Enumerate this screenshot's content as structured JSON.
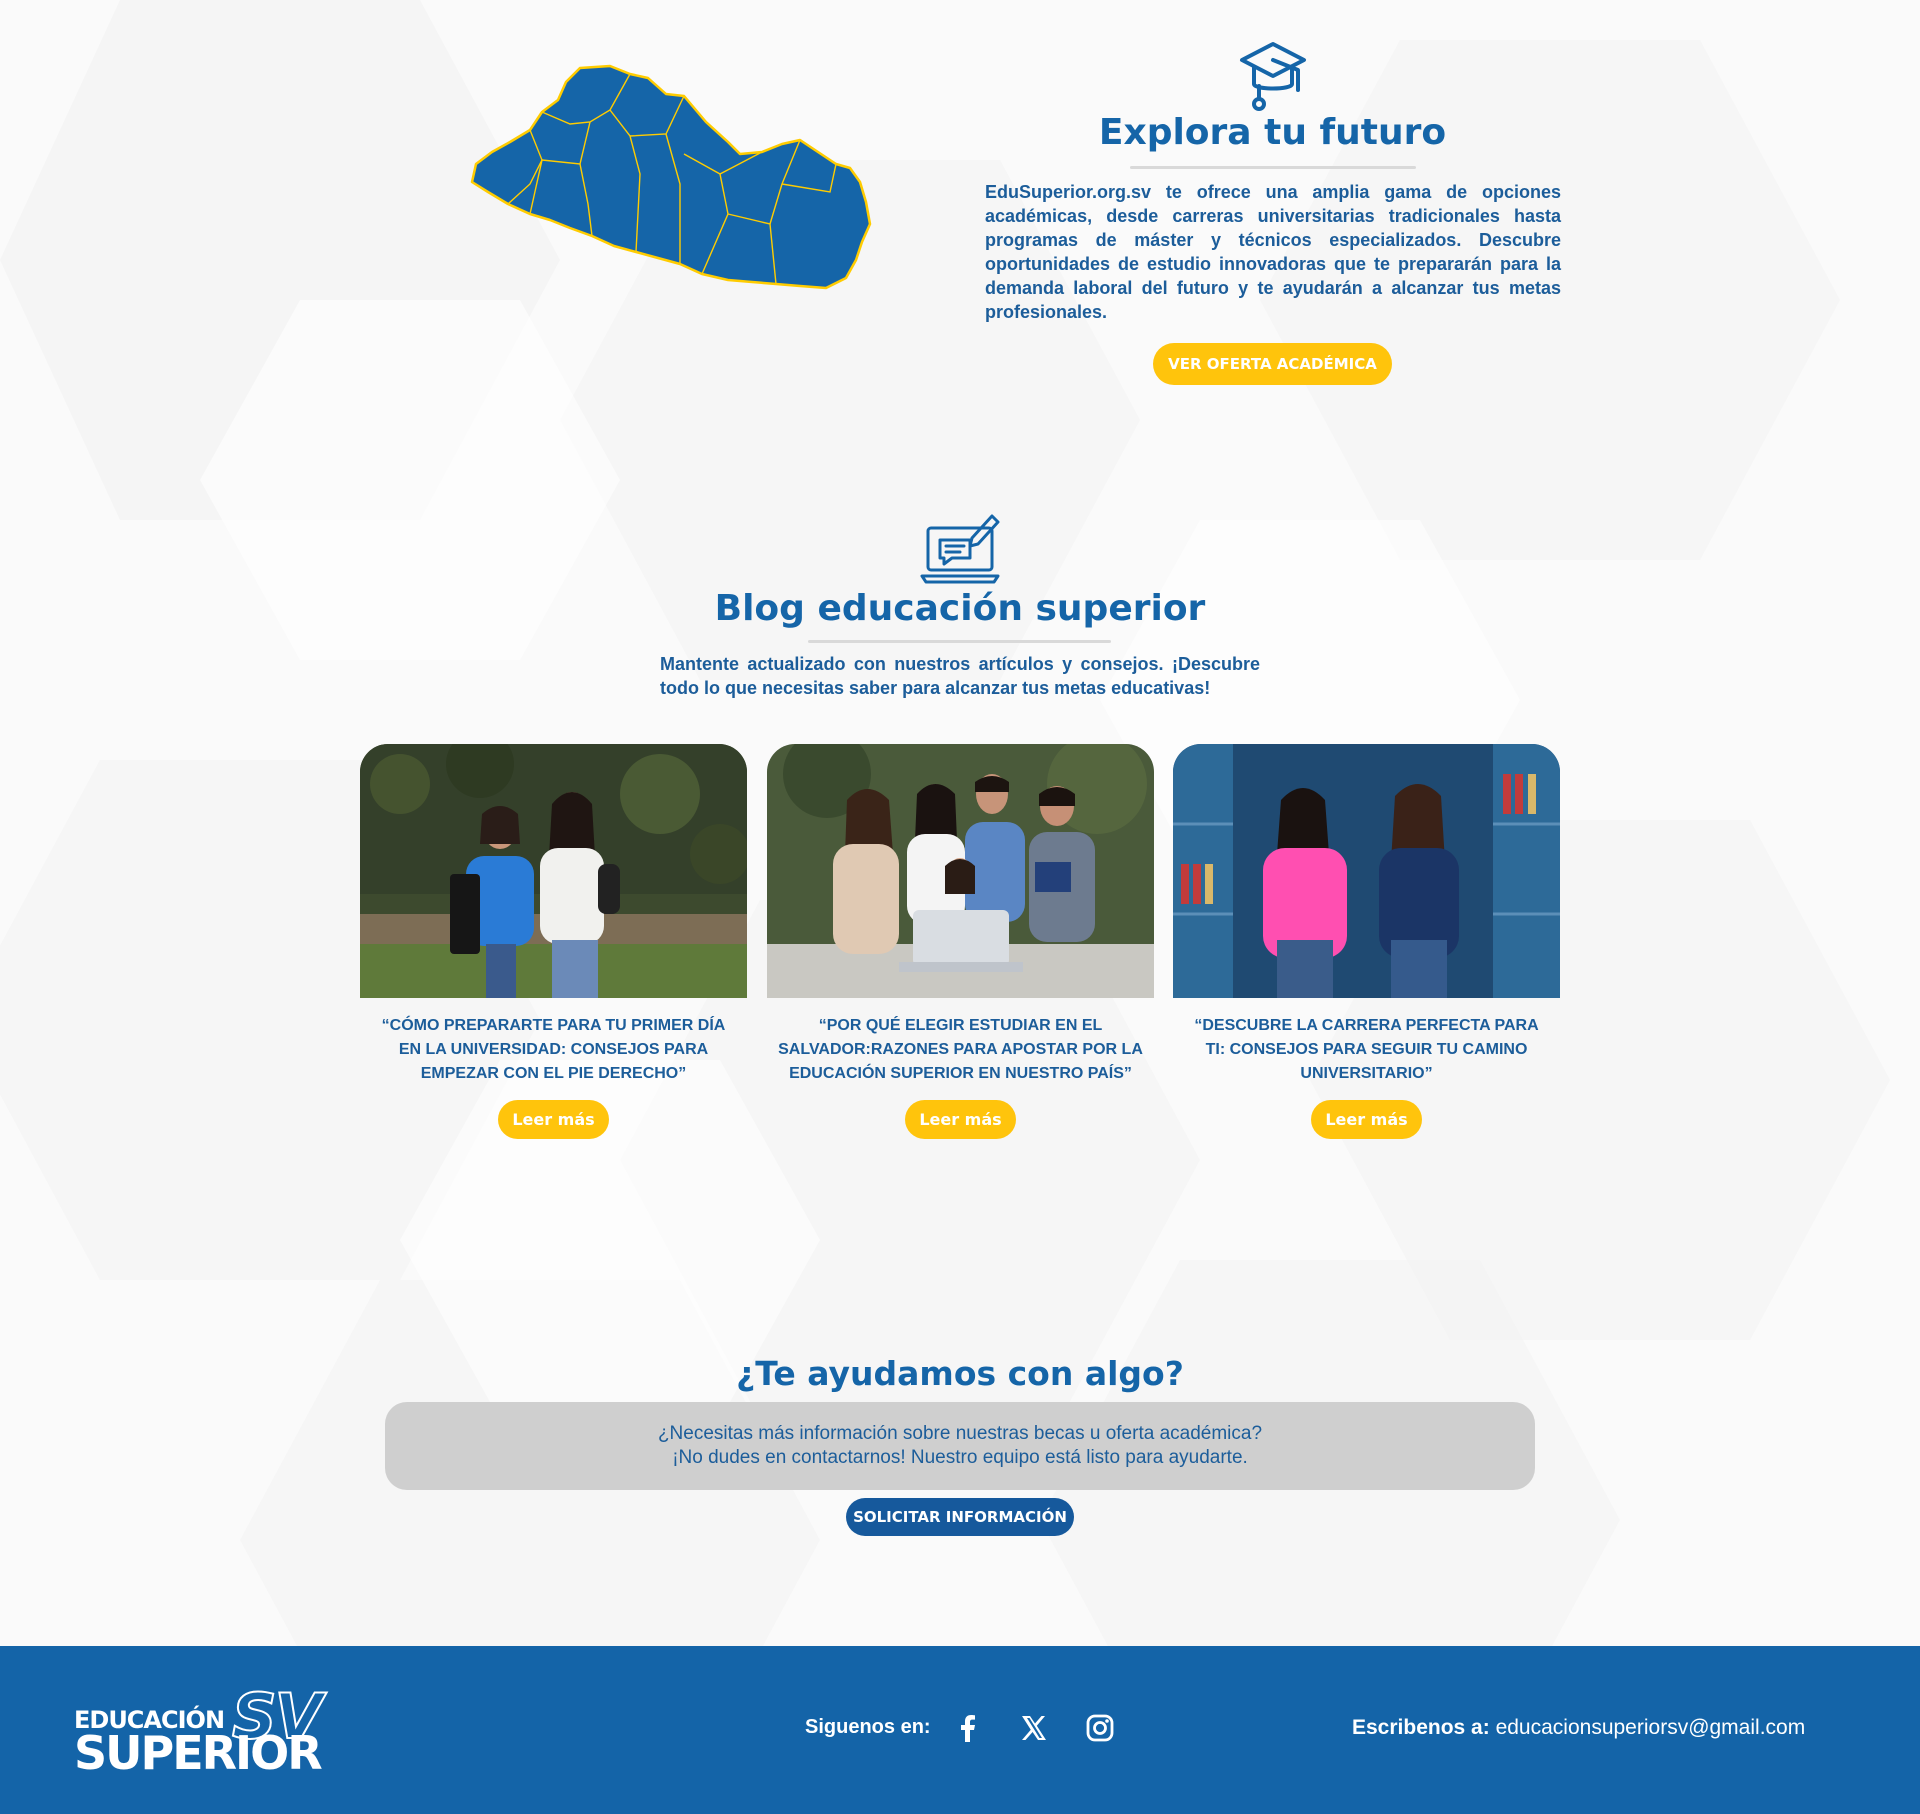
{
  "colors": {
    "primary_blue": "#1565a8",
    "yellow": "#ffc40c",
    "footer_blue": "#1464a8",
    "help_box_gray": "#cfcfcf"
  },
  "explora": {
    "icon": "graduation-cap-icon",
    "title": "Explora tu futuro",
    "text": "EduSuperior.org.sv te ofrece una amplia gama de opciones académicas, desde carreras universitarias tradicionales hasta programas de máster y técnicos especializados. Descubre oportunidades de estudio innovadoras que te prepararán para la demanda laboral del futuro y te ayudarán a alcanzar tus metas profesionales.",
    "button": "VER OFERTA ACADÉMICA"
  },
  "blog": {
    "icon": "laptop-chat-icon",
    "title": "Blog educación superior",
    "text": "Mantente actualizado con nuestros artículos y consejos. ¡Descubre todo lo que necesitas saber para alcanzar tus metas educativas!",
    "cards": [
      {
        "title": "“CÓMO PREPARARTE PARA TU PRIMER DÍA EN LA UNIVERSIDAD: CONSEJOS PARA EMPEZAR CON EL PIE DERECHO”",
        "button": "Leer más"
      },
      {
        "title": "“POR QUÉ ELEGIR ESTUDIAR EN EL SALVADOR:RAZONES PARA APOSTAR POR LA EDUCACIÓN SUPERIOR EN NUESTRO PAÍS”",
        "button": "Leer más"
      },
      {
        "title": "“DESCUBRE LA CARRERA PERFECTA PARA TI: CONSEJOS PARA SEGUIR TU CAMINO UNIVERSITARIO”",
        "button": "Leer más"
      }
    ]
  },
  "help": {
    "title": "¿Te ayudamos con algo?",
    "line1": "¿Necesitas más información sobre nuestras becas u oferta académica?",
    "line2": "¡No dudes en contactarnos! Nuestro equipo está listo para ayudarte.",
    "button": "SOLICITAR INFORMACIÓN"
  },
  "footer": {
    "logo_top": "EDUCACIÓN",
    "logo_bottom": "SUPERIOR",
    "logo_sv": "SV",
    "follow_label": "Siguenos en:",
    "social": [
      "facebook-icon",
      "x-icon",
      "instagram-icon"
    ],
    "mail_label": "Escribenos a:",
    "mail": "educacionsuperiorsv@gmail.com"
  }
}
